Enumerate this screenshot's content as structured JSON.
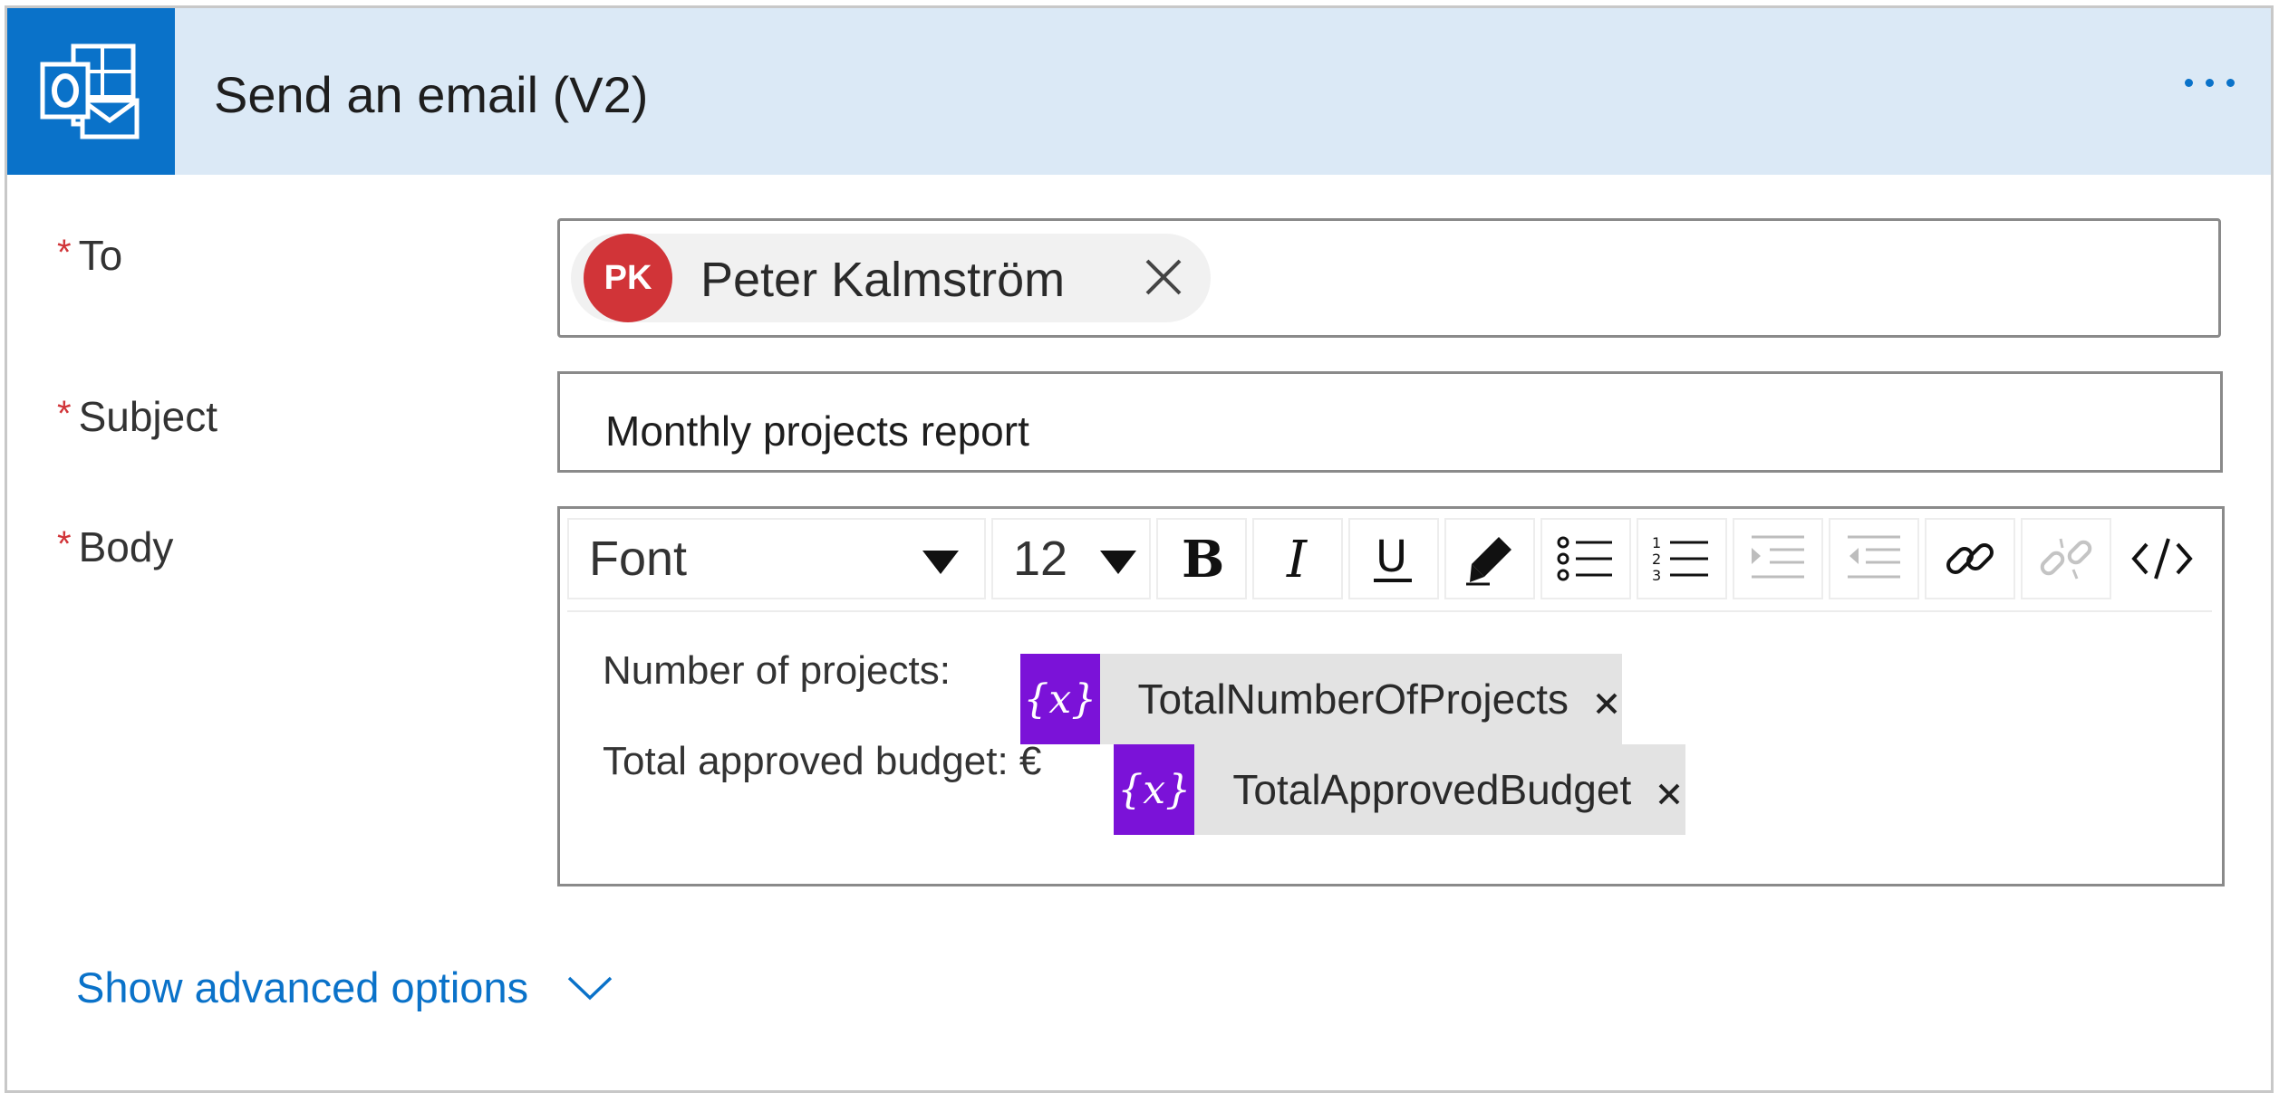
{
  "card": {
    "title": "Send an email (V2)",
    "app_icon": "outlook-icon",
    "more_icon": "more-options-icon"
  },
  "fields": {
    "to": {
      "required_mark": "*",
      "label": "To",
      "recipient": {
        "initials": "PK",
        "name": "Peter Kalmström",
        "avatar_color": "#d13438"
      }
    },
    "subject": {
      "required_mark": "*",
      "label": "Subject",
      "value": "Monthly projects report"
    },
    "body": {
      "required_mark": "*",
      "label": "Body",
      "toolbar": {
        "font_value": "Font",
        "size_value": "12",
        "buttons": [
          "bold-icon",
          "italic-icon",
          "underline-icon",
          "highlight-pen-icon",
          "bullet-list-icon",
          "numbered-list-icon",
          "indent-icon",
          "outdent-icon",
          "link-icon",
          "unlink-icon",
          "code-view-icon"
        ]
      },
      "lines": [
        {
          "text": "Number of projects:",
          "token": "TotalNumberOfProjects"
        },
        {
          "text": "Total approved budget: €",
          "token": "TotalApprovedBudget"
        }
      ],
      "token_icon_text": "{x}",
      "token_color": "#7b12d8"
    }
  },
  "advanced": {
    "label": "Show advanced options"
  },
  "colors": {
    "header_bg": "#dbe9f6",
    "accent": "#0a72c9",
    "required": "#d13438"
  }
}
